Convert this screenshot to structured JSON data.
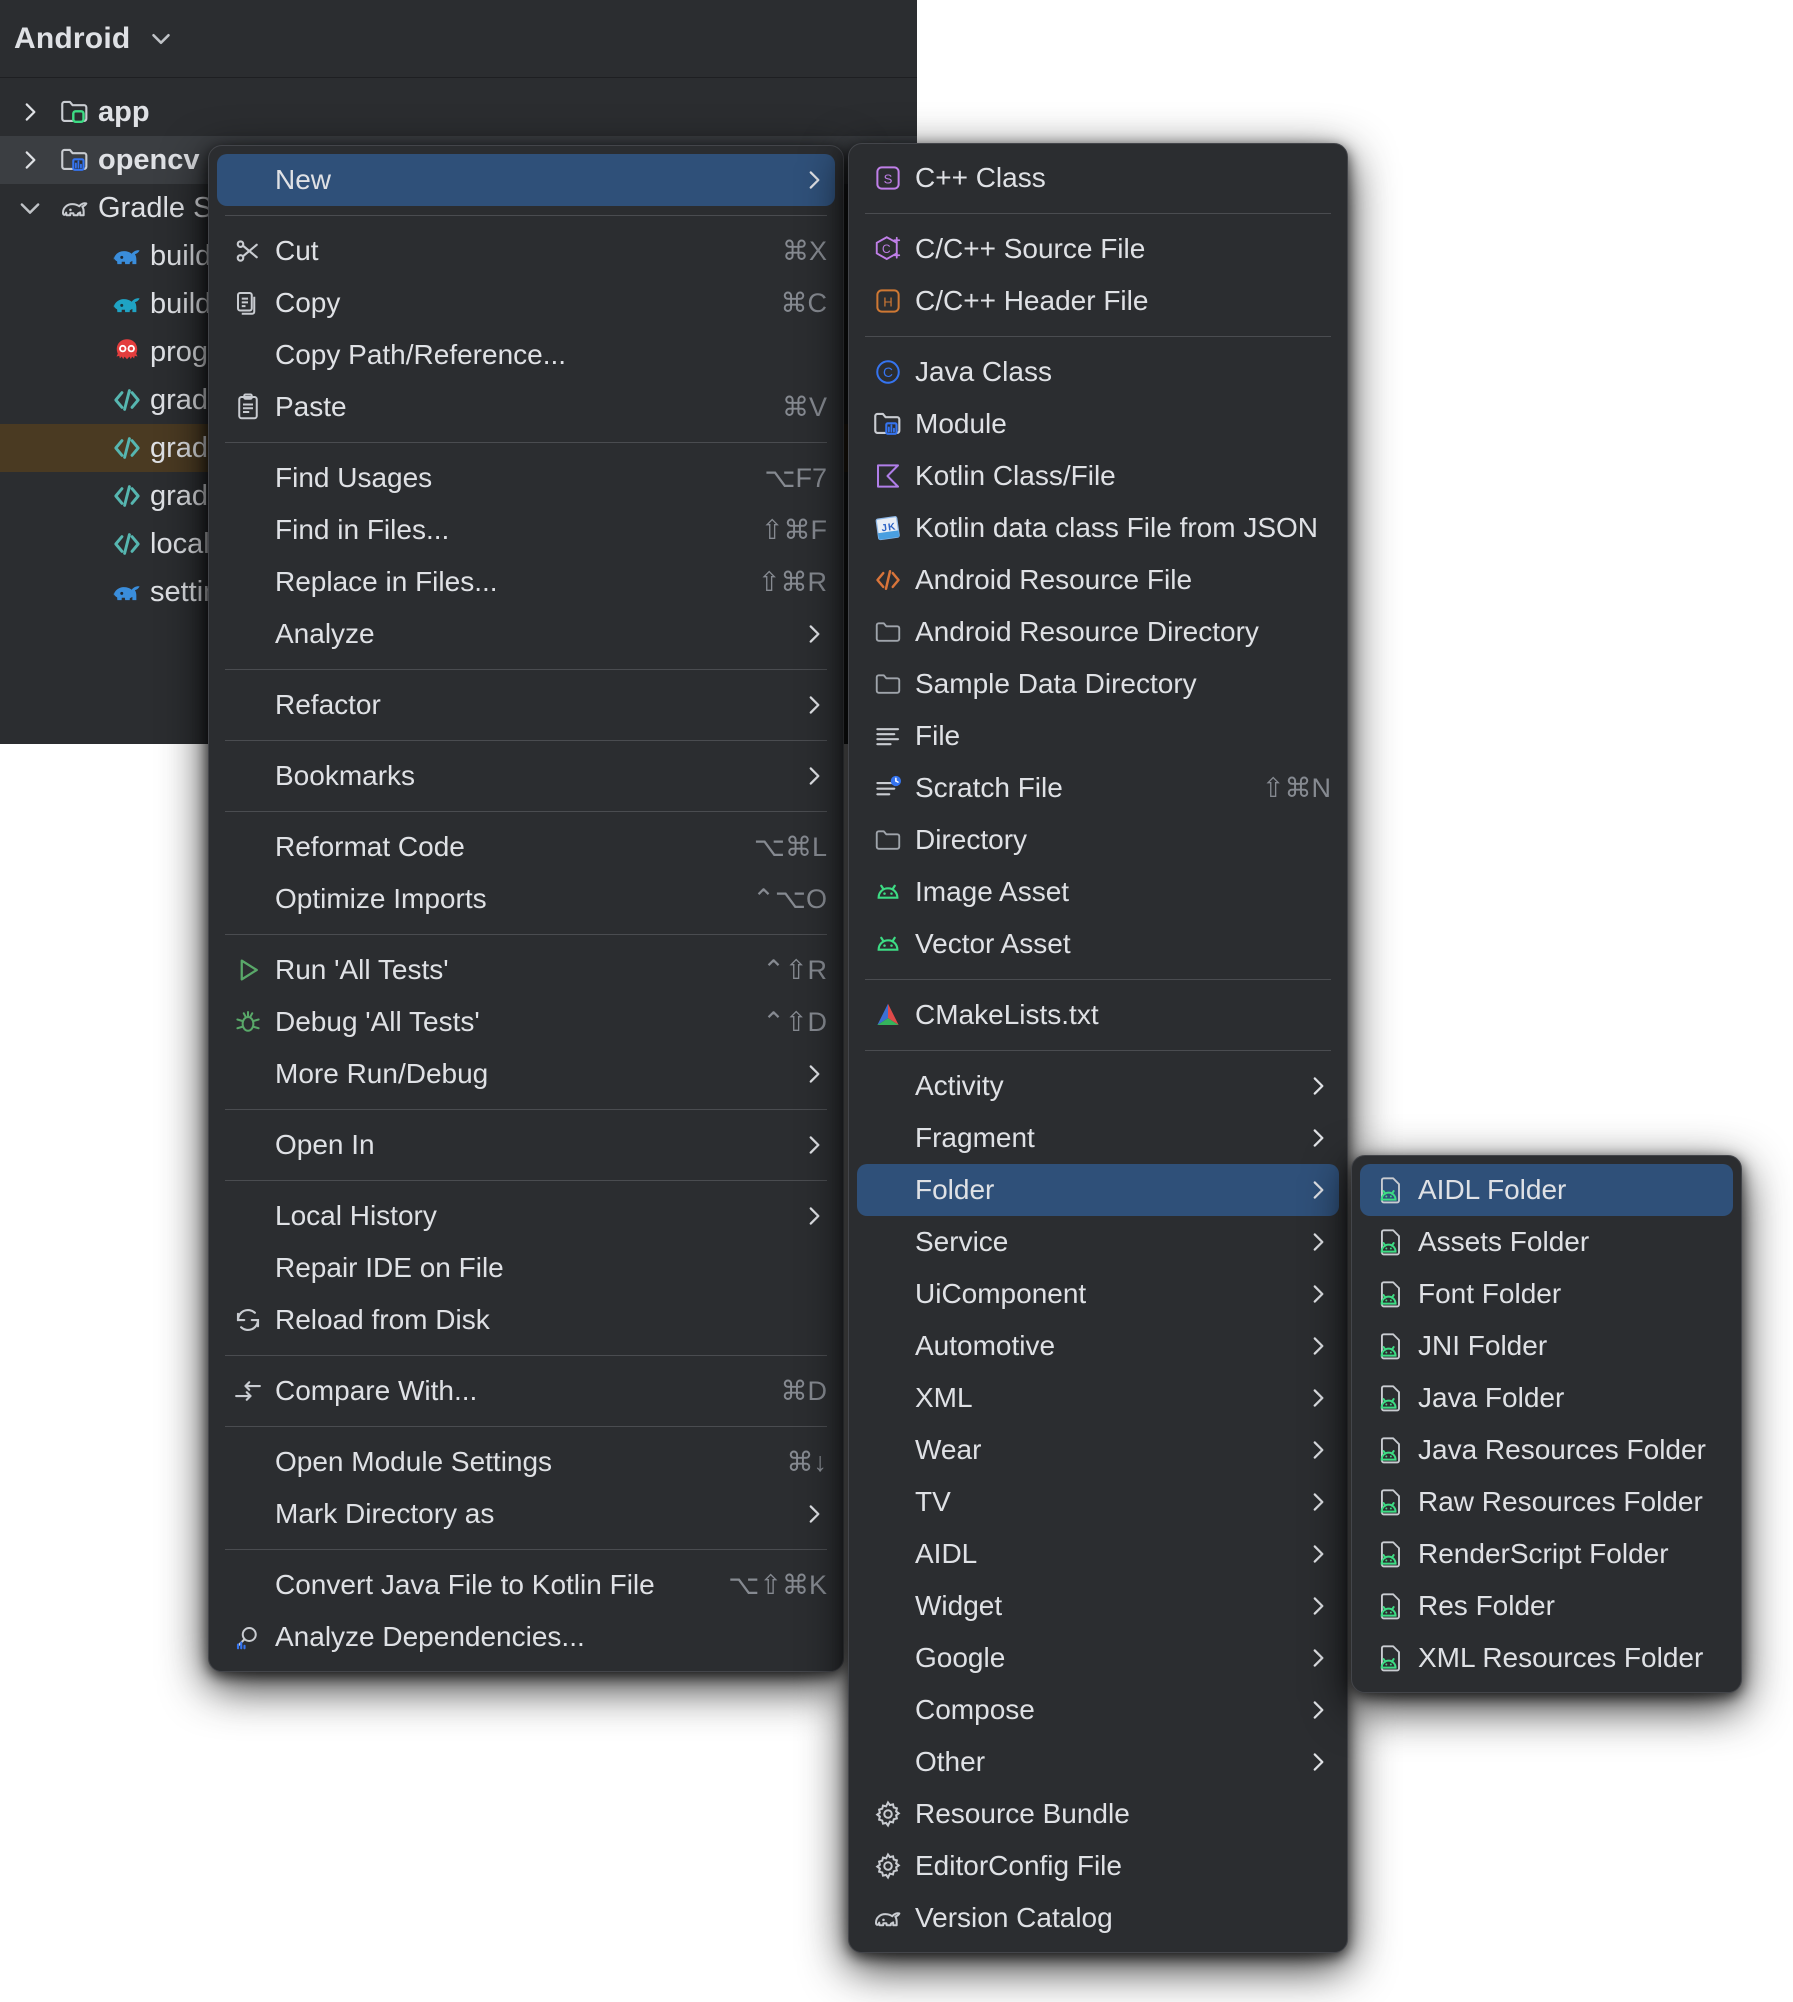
{
  "toolwindow": {
    "title": "Android",
    "title_chevron_icon": "chevron-down-icon",
    "tree": [
      {
        "label": "app",
        "icon": "module-folder-green-icon",
        "arrow": "chevron-right-icon",
        "indent": 0,
        "bold": true,
        "state": "none"
      },
      {
        "label": "opencv",
        "icon": "module-folder-blue-icon",
        "arrow": "chevron-right-icon",
        "indent": 0,
        "bold": true,
        "state": "selected-grey"
      },
      {
        "label": "Gradle S",
        "icon": "gradle-elephant-outline-icon",
        "arrow": "chevron-down-icon",
        "indent": 0,
        "bold": false,
        "state": "none"
      },
      {
        "label": "build.",
        "icon": "gradle-elephant-blue-icon",
        "arrow": "",
        "indent": 1,
        "bold": false,
        "state": "none"
      },
      {
        "label": "build.",
        "icon": "gradle-elephant-cyan-icon",
        "arrow": "",
        "indent": 1,
        "bold": false,
        "state": "none"
      },
      {
        "label": "progu",
        "icon": "proguard-owl-icon",
        "arrow": "",
        "indent": 1,
        "bold": false,
        "state": "none"
      },
      {
        "label": "gradle",
        "icon": "properties-code-icon",
        "arrow": "",
        "indent": 1,
        "bold": false,
        "state": "none"
      },
      {
        "label": "gradle",
        "icon": "properties-code-icon",
        "arrow": "",
        "indent": 1,
        "bold": false,
        "state": "selected-amber"
      },
      {
        "label": "gradle",
        "icon": "properties-code-icon",
        "arrow": "",
        "indent": 1,
        "bold": false,
        "state": "none"
      },
      {
        "label": "local.p",
        "icon": "properties-code-icon",
        "arrow": "",
        "indent": 1,
        "bold": false,
        "state": "none"
      },
      {
        "label": "settin",
        "icon": "gradle-elephant-blue-icon",
        "arrow": "",
        "indent": 1,
        "bold": false,
        "state": "none"
      }
    ]
  },
  "context_menu": {
    "items": [
      {
        "label": "New",
        "icon": "",
        "shortcut": "",
        "arrow": "chevron-right-icon",
        "highlight": true
      },
      {
        "sep": true
      },
      {
        "label": "Cut",
        "icon": "scissors-icon",
        "shortcut": "⌘X",
        "arrow": ""
      },
      {
        "label": "Copy",
        "icon": "copy-icon",
        "shortcut": "⌘C",
        "arrow": ""
      },
      {
        "label": "Copy Path/Reference...",
        "icon": "",
        "shortcut": "",
        "arrow": ""
      },
      {
        "label": "Paste",
        "icon": "paste-clipboard-icon",
        "shortcut": "⌘V",
        "arrow": ""
      },
      {
        "sep": true
      },
      {
        "label": "Find Usages",
        "icon": "",
        "shortcut": "⌥F7",
        "arrow": ""
      },
      {
        "label": "Find in Files...",
        "icon": "",
        "shortcut": "⇧⌘F",
        "arrow": ""
      },
      {
        "label": "Replace in Files...",
        "icon": "",
        "shortcut": "⇧⌘R",
        "arrow": ""
      },
      {
        "label": "Analyze",
        "icon": "",
        "shortcut": "",
        "arrow": "chevron-right-icon"
      },
      {
        "sep": true
      },
      {
        "label": "Refactor",
        "icon": "",
        "shortcut": "",
        "arrow": "chevron-right-icon"
      },
      {
        "sep": true
      },
      {
        "label": "Bookmarks",
        "icon": "",
        "shortcut": "",
        "arrow": "chevron-right-icon"
      },
      {
        "sep": true
      },
      {
        "label": "Reformat Code",
        "icon": "",
        "shortcut": "⌥⌘L",
        "arrow": ""
      },
      {
        "label": "Optimize Imports",
        "icon": "",
        "shortcut": "⌃⌥O",
        "arrow": ""
      },
      {
        "sep": true
      },
      {
        "label": "Run 'All Tests'",
        "icon": "run-play-icon",
        "shortcut": "⌃⇧R",
        "arrow": ""
      },
      {
        "label": "Debug 'All Tests'",
        "icon": "debug-bug-icon",
        "shortcut": "⌃⇧D",
        "arrow": ""
      },
      {
        "label": "More Run/Debug",
        "icon": "",
        "shortcut": "",
        "arrow": "chevron-right-icon"
      },
      {
        "sep": true
      },
      {
        "label": "Open In",
        "icon": "",
        "shortcut": "",
        "arrow": "chevron-right-icon"
      },
      {
        "sep": true
      },
      {
        "label": "Local History",
        "icon": "",
        "shortcut": "",
        "arrow": "chevron-right-icon"
      },
      {
        "label": "Repair IDE on File",
        "icon": "",
        "shortcut": "",
        "arrow": ""
      },
      {
        "label": "Reload from Disk",
        "icon": "reload-refresh-icon",
        "shortcut": "",
        "arrow": ""
      },
      {
        "sep": true
      },
      {
        "label": "Compare With...",
        "icon": "compare-arrows-icon",
        "shortcut": "⌘D",
        "arrow": ""
      },
      {
        "sep": true
      },
      {
        "label": "Open Module Settings",
        "icon": "",
        "shortcut": "⌘↓",
        "arrow": ""
      },
      {
        "label": "Mark Directory as",
        "icon": "",
        "shortcut": "",
        "arrow": "chevron-right-icon"
      },
      {
        "sep": true
      },
      {
        "label": "Convert Java File to Kotlin File",
        "icon": "",
        "shortcut": "⌥⇧⌘K",
        "arrow": ""
      },
      {
        "label": "Analyze Dependencies...",
        "icon": "analyze-dependencies-icon",
        "shortcut": "",
        "arrow": ""
      }
    ]
  },
  "new_menu": {
    "items": [
      {
        "label": "C++ Class",
        "icon": "cpp-class-purple-icon",
        "shortcut": "",
        "arrow": ""
      },
      {
        "sep": true
      },
      {
        "label": "C/C++ Source File",
        "icon": "cpp-source-purple-icon",
        "shortcut": "",
        "arrow": ""
      },
      {
        "label": "C/C++ Header File",
        "icon": "cpp-header-orange-icon",
        "shortcut": "",
        "arrow": ""
      },
      {
        "sep": true
      },
      {
        "label": "Java Class",
        "icon": "java-class-blue-icon",
        "shortcut": "",
        "arrow": ""
      },
      {
        "label": "Module",
        "icon": "module-folder-blue-icon",
        "shortcut": "",
        "arrow": ""
      },
      {
        "label": "Kotlin Class/File",
        "icon": "kotlin-purple-icon",
        "shortcut": "",
        "arrow": ""
      },
      {
        "label": "Kotlin data class File from JSON",
        "icon": "kotlin-json-icon",
        "shortcut": "",
        "arrow": ""
      },
      {
        "label": "Android Resource File",
        "icon": "android-resource-code-icon",
        "shortcut": "",
        "arrow": ""
      },
      {
        "label": "Android Resource Directory",
        "icon": "folder-grey-icon",
        "shortcut": "",
        "arrow": ""
      },
      {
        "label": "Sample Data Directory",
        "icon": "folder-grey-icon",
        "shortcut": "",
        "arrow": ""
      },
      {
        "label": "File",
        "icon": "file-lines-icon",
        "shortcut": "",
        "arrow": ""
      },
      {
        "label": "Scratch File",
        "icon": "scratch-file-icon",
        "shortcut": "⇧⌘N",
        "arrow": ""
      },
      {
        "label": "Directory",
        "icon": "folder-grey-icon",
        "shortcut": "",
        "arrow": ""
      },
      {
        "label": "Image Asset",
        "icon": "android-green-icon",
        "shortcut": "",
        "arrow": ""
      },
      {
        "label": "Vector Asset",
        "icon": "android-green-icon",
        "shortcut": "",
        "arrow": ""
      },
      {
        "sep": true
      },
      {
        "label": "CMakeLists.txt",
        "icon": "cmake-triangle-icon",
        "shortcut": "",
        "arrow": ""
      },
      {
        "sep": true
      },
      {
        "label": "Activity",
        "icon": "",
        "shortcut": "",
        "arrow": "chevron-right-icon"
      },
      {
        "label": "Fragment",
        "icon": "",
        "shortcut": "",
        "arrow": "chevron-right-icon"
      },
      {
        "label": "Folder",
        "icon": "",
        "shortcut": "",
        "arrow": "chevron-right-icon",
        "highlight": true
      },
      {
        "label": "Service",
        "icon": "",
        "shortcut": "",
        "arrow": "chevron-right-icon"
      },
      {
        "label": "UiComponent",
        "icon": "",
        "shortcut": "",
        "arrow": "chevron-right-icon"
      },
      {
        "label": "Automotive",
        "icon": "",
        "shortcut": "",
        "arrow": "chevron-right-icon"
      },
      {
        "label": "XML",
        "icon": "",
        "shortcut": "",
        "arrow": "chevron-right-icon"
      },
      {
        "label": "Wear",
        "icon": "",
        "shortcut": "",
        "arrow": "chevron-right-icon"
      },
      {
        "label": "TV",
        "icon": "",
        "shortcut": "",
        "arrow": "chevron-right-icon"
      },
      {
        "label": "AIDL",
        "icon": "",
        "shortcut": "",
        "arrow": "chevron-right-icon"
      },
      {
        "label": "Widget",
        "icon": "",
        "shortcut": "",
        "arrow": "chevron-right-icon"
      },
      {
        "label": "Google",
        "icon": "",
        "shortcut": "",
        "arrow": "chevron-right-icon"
      },
      {
        "label": "Compose",
        "icon": "",
        "shortcut": "",
        "arrow": "chevron-right-icon"
      },
      {
        "label": "Other",
        "icon": "",
        "shortcut": "",
        "arrow": "chevron-right-icon"
      },
      {
        "label": "Resource Bundle",
        "icon": "gear-icon",
        "shortcut": "",
        "arrow": ""
      },
      {
        "label": "EditorConfig File",
        "icon": "gear-icon",
        "shortcut": "",
        "arrow": ""
      },
      {
        "label": "Version Catalog",
        "icon": "gradle-elephant-outline-icon",
        "shortcut": "",
        "arrow": ""
      }
    ]
  },
  "folder_menu": {
    "items": [
      {
        "label": "AIDL Folder",
        "icon": "android-folder-file-icon",
        "highlight": true
      },
      {
        "label": "Assets Folder",
        "icon": "android-folder-file-icon"
      },
      {
        "label": "Font Folder",
        "icon": "android-folder-file-icon"
      },
      {
        "label": "JNI Folder",
        "icon": "android-folder-file-icon"
      },
      {
        "label": "Java Folder",
        "icon": "android-folder-file-icon"
      },
      {
        "label": "Java Resources Folder",
        "icon": "android-folder-file-icon"
      },
      {
        "label": "Raw Resources Folder",
        "icon": "android-folder-file-icon"
      },
      {
        "label": "RenderScript Folder",
        "icon": "android-folder-file-icon"
      },
      {
        "label": "Res Folder",
        "icon": "android-folder-file-icon"
      },
      {
        "label": "XML Resources Folder",
        "icon": "android-folder-file-icon"
      }
    ]
  },
  "colors": {
    "menu_bg": "#2b2d30",
    "panel_bg": "#2b2d30",
    "highlight": "#2f5079",
    "text": "#dfe1e5",
    "shortcut_text": "#868a91",
    "separator": "#4a4c50",
    "android_green": "#3ddc84",
    "selection_amber": "#4a3a22",
    "kotlin_purple": "#b07ee8",
    "header_orange": "#cf7833"
  }
}
